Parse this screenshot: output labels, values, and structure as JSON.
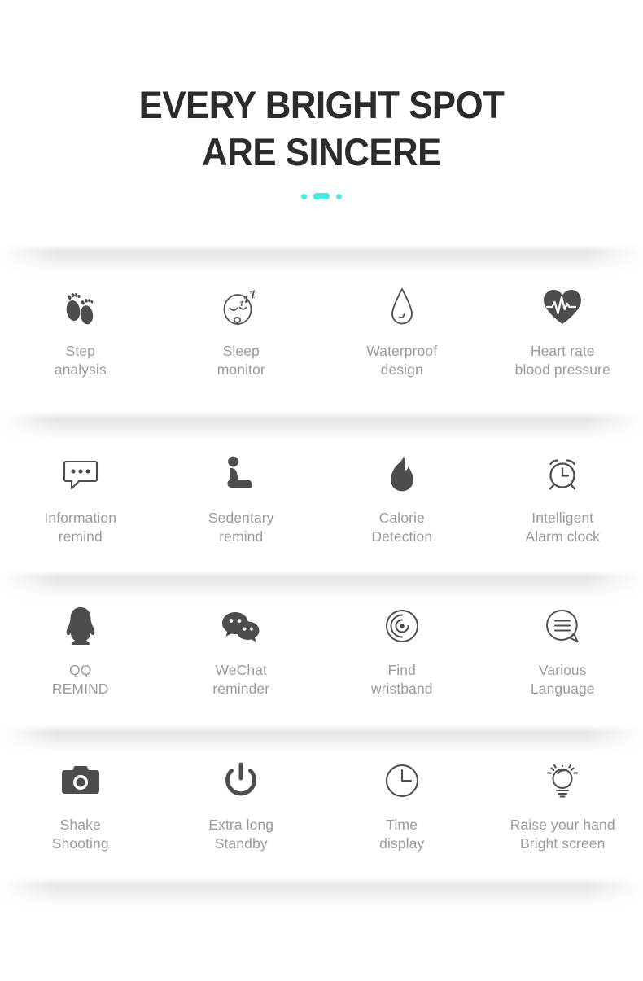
{
  "heading": {
    "title": "EVERY BRIGHT SPOT\nARE SINCERE",
    "accent_color": "#4fe8e0"
  },
  "theme": {
    "background": "#ffffff",
    "title_color": "#2b2b2b",
    "label_color": "#9b9b9b",
    "icon_color": "#4d4d4d",
    "band_color": "#e4e4e6"
  },
  "features": {
    "rows": [
      {
        "items": [
          {
            "icon": "footprints-icon",
            "label": "Step\nanalysis"
          },
          {
            "icon": "sleeping-face-icon",
            "label": "Sleep\nmonitor"
          },
          {
            "icon": "water-drop-icon",
            "label": "Waterproof\ndesign"
          },
          {
            "icon": "heart-rate-icon",
            "label": "Heart rate\nblood pressure"
          }
        ]
      },
      {
        "items": [
          {
            "icon": "speech-bubble-dots-icon",
            "label": "Information\nremind"
          },
          {
            "icon": "seated-person-icon",
            "label": "Sedentary\nremind"
          },
          {
            "icon": "flame-icon",
            "label": "Calorie\nDetection"
          },
          {
            "icon": "alarm-clock-icon",
            "label": "Intelligent\nAlarm clock"
          }
        ]
      },
      {
        "items": [
          {
            "icon": "qq-penguin-icon",
            "label": "QQ\nREMIND"
          },
          {
            "icon": "wechat-bubbles-icon",
            "label": "WeChat\nreminder"
          },
          {
            "icon": "radar-find-icon",
            "label": "Find\nwristband"
          },
          {
            "icon": "language-bubble-icon",
            "label": "Various\nLanguage"
          }
        ]
      },
      {
        "items": [
          {
            "icon": "camera-icon",
            "label": "Shake\nShooting"
          },
          {
            "icon": "power-icon",
            "label": "Extra long\nStandby"
          },
          {
            "icon": "clock-icon",
            "label": "Time\ndisplay"
          },
          {
            "icon": "light-bulb-icon",
            "label": "Raise your hand\nBright screen"
          }
        ]
      }
    ]
  }
}
